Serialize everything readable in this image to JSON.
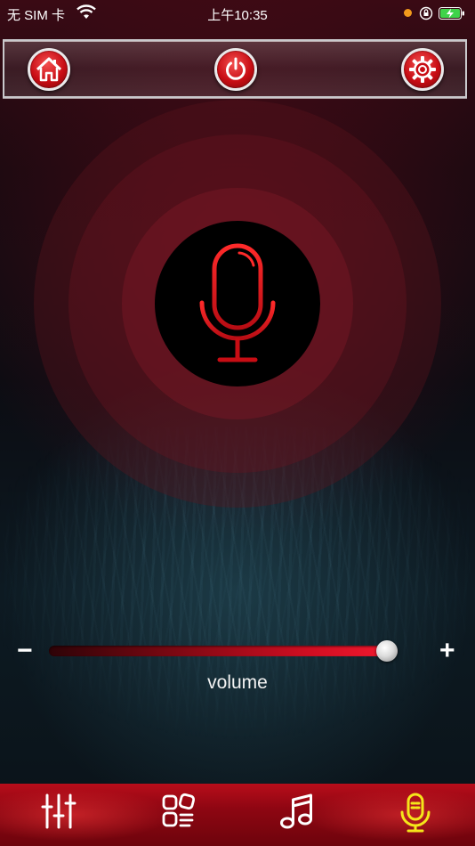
{
  "status_bar": {
    "carrier": "无 SIM 卡",
    "time": "上午10:35",
    "icons": [
      "wifi-icon",
      "recording-dot",
      "orientation-lock-icon",
      "battery-charging-icon"
    ]
  },
  "toolbar": {
    "buttons": [
      {
        "icon": "home-icon"
      },
      {
        "icon": "power-icon"
      },
      {
        "icon": "gear-icon"
      }
    ]
  },
  "mic": {
    "icon": "microphone-icon",
    "color": "#e8141e"
  },
  "volume": {
    "label": "volume",
    "minus": "−",
    "plus": "+",
    "level_fraction": 0.97
  },
  "tabbar": {
    "tabs": [
      {
        "icon": "equalizer-sliders-icon",
        "active": false
      },
      {
        "icon": "apps-grid-icon",
        "active": false
      },
      {
        "icon": "music-note-icon",
        "active": false
      },
      {
        "icon": "microphone-icon",
        "active": true
      }
    ],
    "active_color": "#f5e61a",
    "inactive_color": "#ffffff"
  }
}
